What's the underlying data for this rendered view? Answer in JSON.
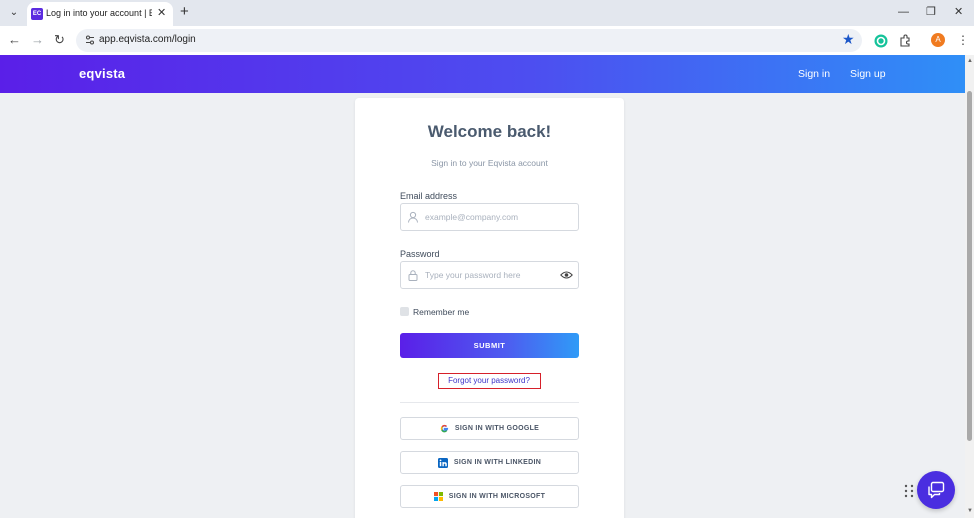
{
  "browser": {
    "tab_title": "Log in into your account | Eqvis",
    "tab_favicon": "EC",
    "url": "app.eqvista.com/login",
    "profile_initial": "A"
  },
  "icons": {
    "tab_menu": "chevron-down-icon",
    "back": "arrow-left-icon",
    "forward": "arrow-right-icon",
    "reload": "reload-icon",
    "star": "star-icon",
    "eye": "eye-icon"
  },
  "colors": {
    "brand_start": "#5a1fe8",
    "brand_end": "#2f8ff7",
    "forgot_highlight": "#d6202a",
    "chat": "#4a2ee0"
  },
  "app": {
    "logo": "eqvista",
    "nav": {
      "signin": "Sign in",
      "signup": "Sign up"
    }
  },
  "login": {
    "title": "Welcome back!",
    "subtitle": "Sign in to your Eqvista account",
    "email_label": "Email address",
    "email_placeholder": "example@company.com",
    "password_label": "Password",
    "password_placeholder": "Type your password here",
    "remember_label": "Remember me",
    "submit_label": "SUBMIT",
    "forgot_label": "Forgot your password?",
    "google_label": "SIGN IN WITH GOOGLE",
    "linkedin_label": "SIGN IN WITH LINKEDIN",
    "microsoft_label": "SIGN IN WITH MICROSOFT"
  }
}
